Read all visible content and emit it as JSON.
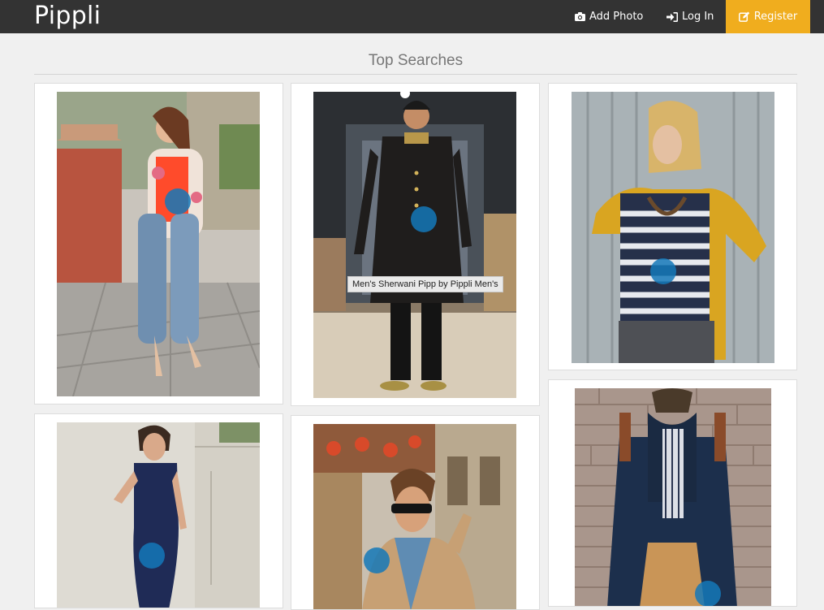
{
  "app": {
    "brand": "Pippli"
  },
  "nav": {
    "add_photo": "Add Photo",
    "login": "Log In",
    "register": "Register",
    "add_photo_icon": "camera-icon",
    "login_icon": "sign-in-icon",
    "register_icon": "edit-icon"
  },
  "colors": {
    "navbar": "#333333",
    "register_accent": "#f0ad1e",
    "pin": "#1478b9"
  },
  "section": {
    "title": "Top Searches"
  },
  "cards": [
    {
      "subject": "woman in floral blazer and ripped jeans"
    },
    {
      "subject": "man in black sherwani on runway",
      "tooltip": "Men's Sherwani Pipp by Pippli Men's"
    },
    {
      "subject": "woman in yellow cardigan and striped top"
    },
    {
      "subject": "woman in navy jumpsuit"
    },
    {
      "subject": "man in tan blazer with sunglasses"
    },
    {
      "subject": "man in navy peacoat and scarf"
    }
  ]
}
